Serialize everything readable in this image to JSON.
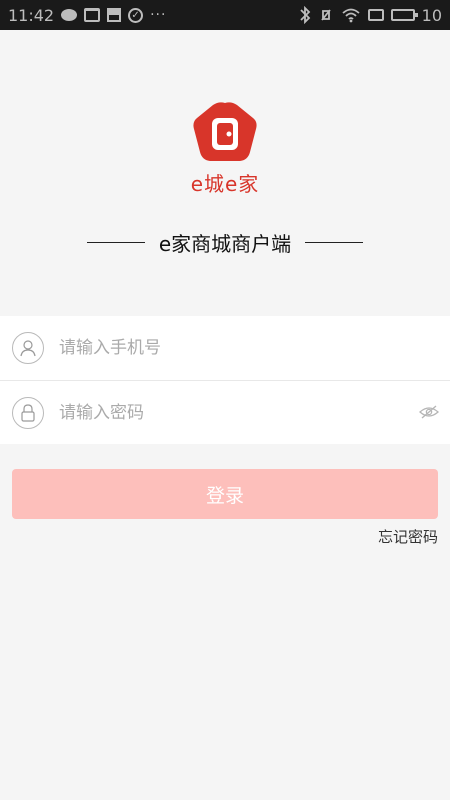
{
  "status_bar": {
    "time": "11:42",
    "battery": "10",
    "left_icons": [
      "chat-icon",
      "shirt-icon",
      "save-icon",
      "check-circle-icon",
      "more-dots-icon"
    ],
    "right_icons": [
      "bluetooth-icon",
      "mute-icon",
      "wifi-icon",
      "screen-icon",
      "battery-icon"
    ]
  },
  "brand": {
    "logo_icon": "door-shield-logo",
    "logo_text": "e城e家",
    "subtitle": "e家商城商户端"
  },
  "form": {
    "phone": {
      "icon": "user-icon",
      "placeholder": "请输入手机号",
      "value": ""
    },
    "password": {
      "icon": "lock-icon",
      "placeholder": "请输入密码",
      "value": "",
      "toggle_icon": "eye-icon"
    }
  },
  "actions": {
    "login_label": "登录",
    "forgot_label": "忘记密码"
  },
  "colors": {
    "brand_red": "#d8352a",
    "login_button": "#fdbfbb",
    "background": "#f5f5f5"
  }
}
